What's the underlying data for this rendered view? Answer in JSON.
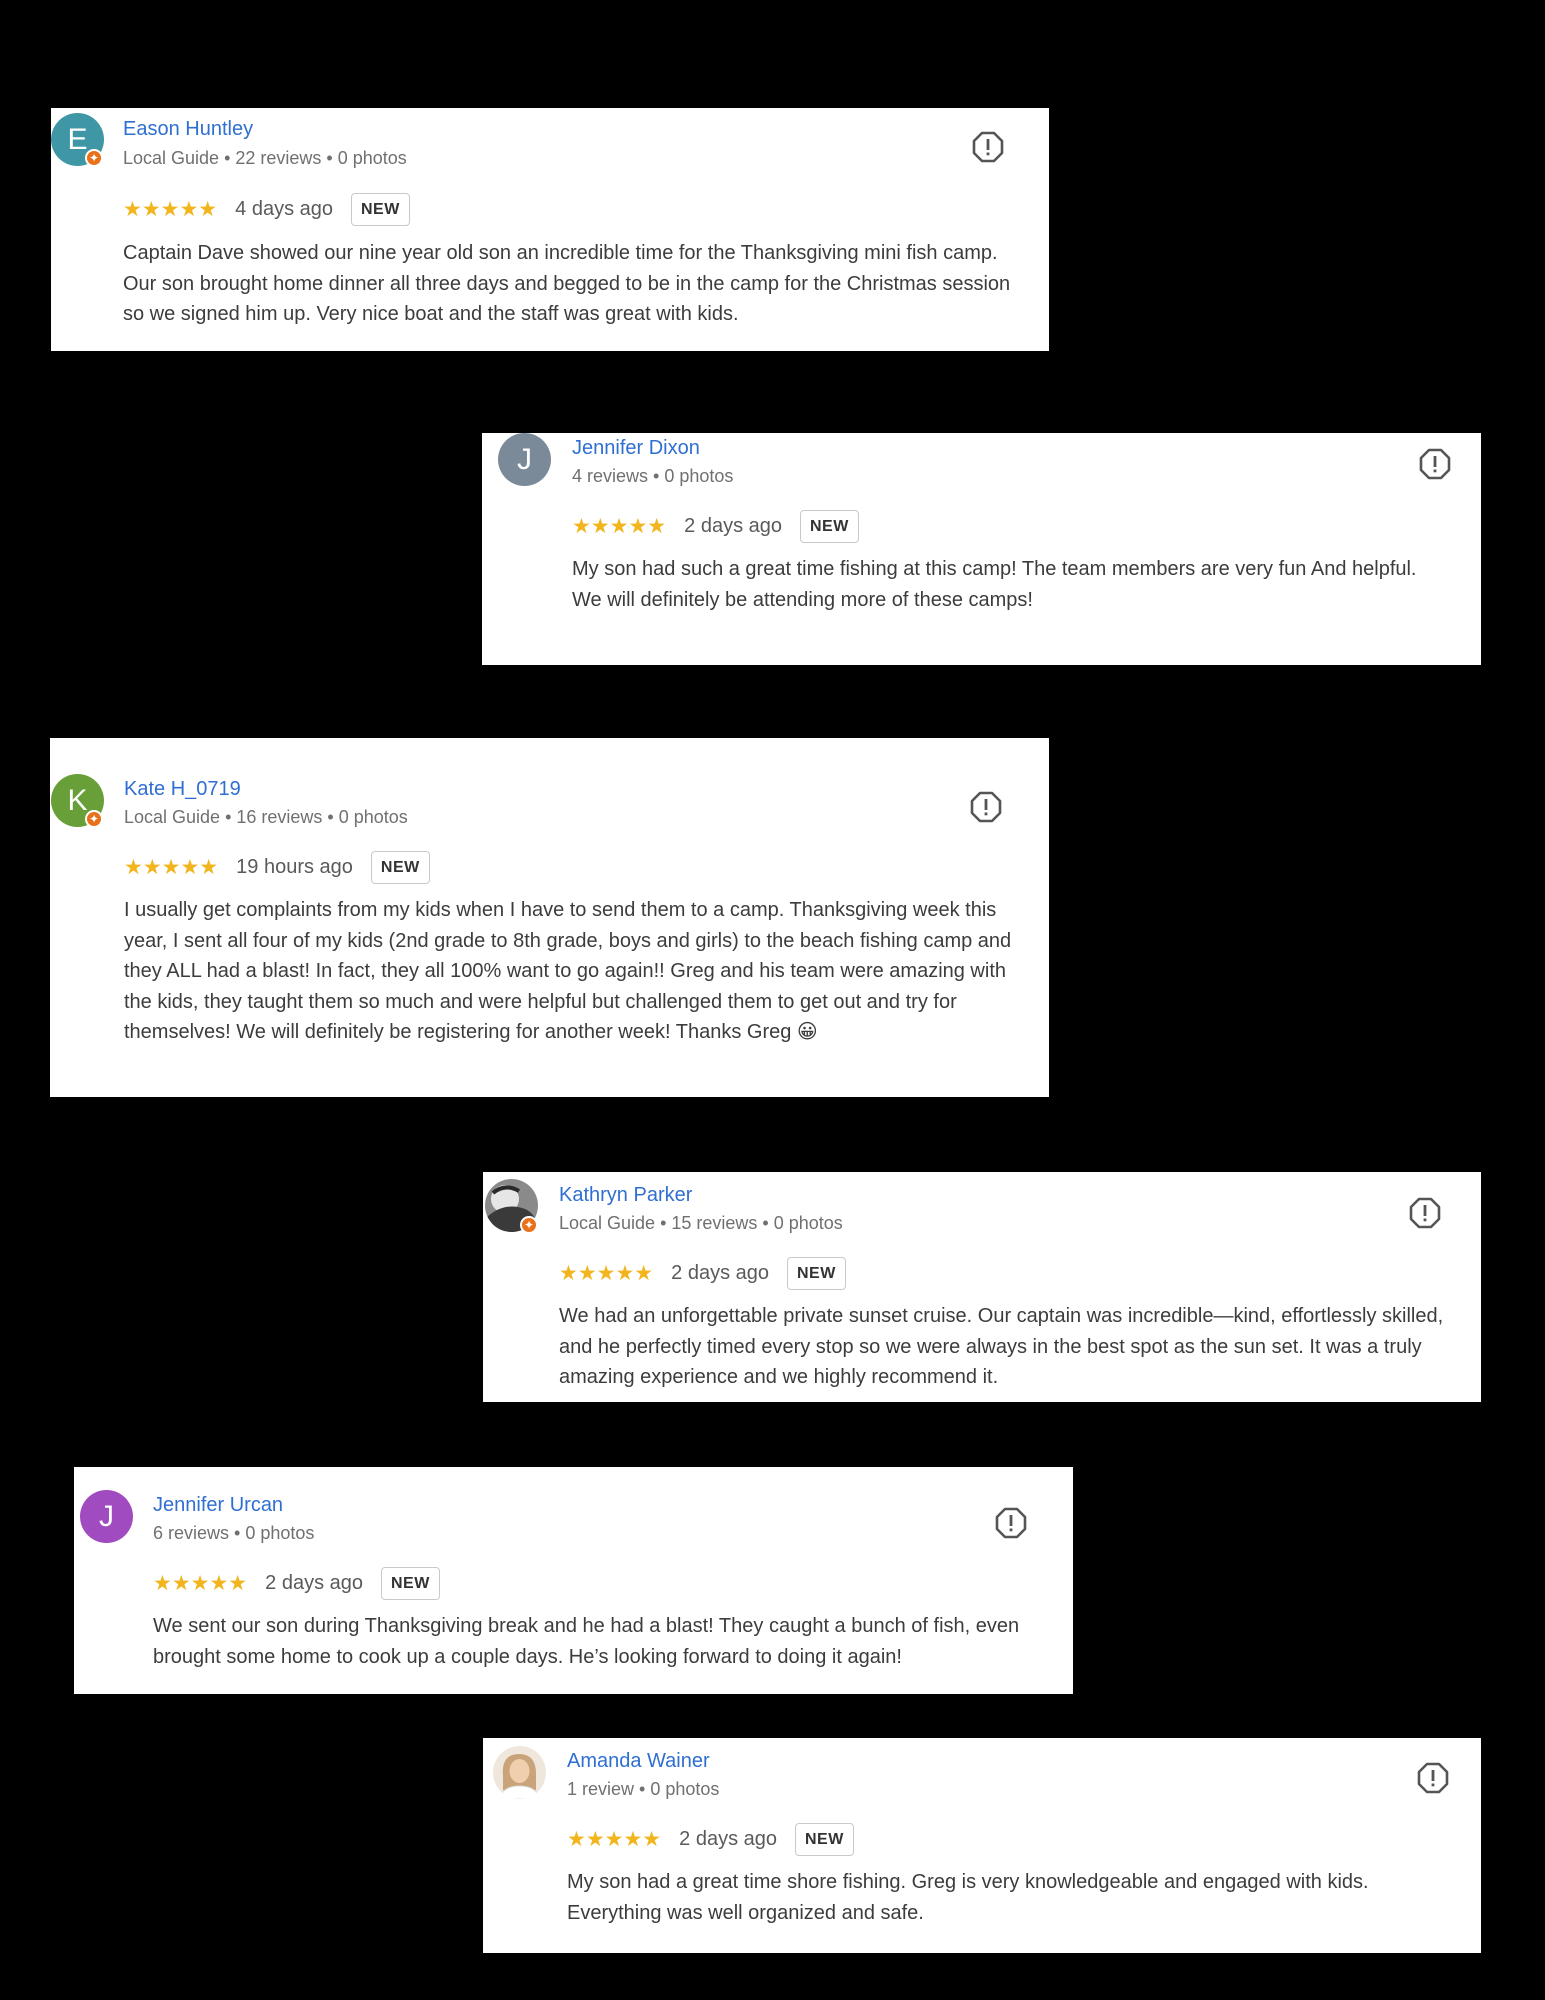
{
  "reviews": [
    {
      "name": "Eason Huntley",
      "initial": "E",
      "avatar_color": "#3f97a6",
      "local_guide": true,
      "meta": "Local Guide • 22 reviews • 0 photos",
      "stars": "★★★★★",
      "rating": 5,
      "when": "4 days ago",
      "badge": "NEW",
      "text": [
        "Captain Dave showed our nine year old son an incredible time for the Thanksgiving mini fish camp. Our son brought home dinner all three days and begged to be in the camp for the Christmas session so we signed him up. Very nice boat and the staff was great with kids."
      ]
    },
    {
      "name": "Jennifer Dixon",
      "initial": "J",
      "avatar_color": "#7b8a99",
      "local_guide": false,
      "meta": "4 reviews • 0 photos",
      "stars": "★★★★★",
      "rating": 5,
      "when": "2 days ago",
      "badge": "NEW",
      "text": [
        "My son had such a great time fishing at this camp! The team members are very fun And helpful.",
        "We will definitely be attending more of these camps!"
      ]
    },
    {
      "name": "Kate H_0719",
      "initial": "K",
      "avatar_color": "#689f38",
      "local_guide": true,
      "meta": "Local Guide • 16 reviews • 0 photos",
      "stars": "★★★★★",
      "rating": 5,
      "when": "19 hours ago",
      "badge": "NEW",
      "text": [
        "I usually get complaints from my kids when I have to send them to a camp. Thanksgiving week this year, I sent all four of my kids (2nd grade to 8th grade, boys and girls) to the beach fishing camp and they ALL had a blast! In fact, they all 100% want to go again!! Greg and his team were amazing with the kids, they taught them so much and were helpful but challenged them to get out and try for themselves! We will definitely be registering for another week! Thanks Greg 😀"
      ]
    },
    {
      "name": "Kathryn Parker",
      "initial": "",
      "avatar_color": "#9a9a9a",
      "local_guide": true,
      "meta": "Local Guide • 15 reviews • 0 photos",
      "stars": "★★★★★",
      "rating": 5,
      "when": "2 days ago",
      "badge": "NEW",
      "text": [
        "We had an unforgettable private sunset cruise. Our captain was incredible—kind, effortlessly skilled, and he perfectly timed every stop so we were always in the best spot as the sun set. It was a truly amazing experience and we highly recommend it."
      ]
    },
    {
      "name": "Jennifer Urcan",
      "initial": "J",
      "avatar_color": "#a04bbf",
      "local_guide": false,
      "meta": "6 reviews • 0 photos",
      "stars": "★★★★★",
      "rating": 5,
      "when": "2 days ago",
      "badge": "NEW",
      "text": [
        "We sent our son during Thanksgiving break and he had a blast! They caught a bunch of fish, even brought some home to cook up a couple days. He’s looking forward to doing it again!"
      ]
    },
    {
      "name": "Amanda Wainer",
      "initial": "",
      "avatar_color": "#d9c8b4",
      "local_guide": false,
      "meta": "1 review • 0 photos",
      "stars": "★★★★★",
      "rating": 5,
      "when": "2 days ago",
      "badge": "NEW",
      "text": [
        "My son had a great time shore fishing. Greg is very knowledgeable and engaged with kids. Everything was well organized and safe."
      ]
    }
  ]
}
